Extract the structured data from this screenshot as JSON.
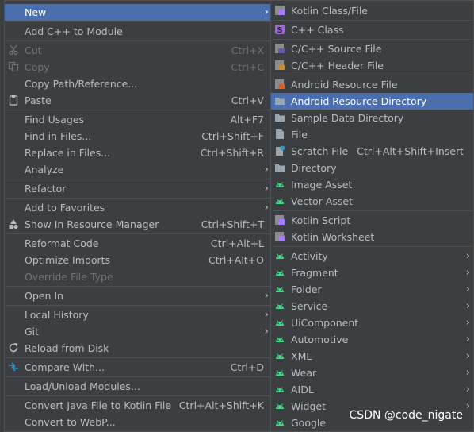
{
  "left_menu": {
    "new": "New",
    "add_cpp": "Add C++ to Module",
    "cut": "Cut",
    "cut_sc": "Ctrl+X",
    "copy": "Copy",
    "copy_sc": "Ctrl+C",
    "copy_path": "Copy Path/Reference...",
    "paste": "Paste",
    "paste_sc": "Ctrl+V",
    "find_usages": "Find Usages",
    "find_usages_sc": "Alt+F7",
    "find_in_files": "Find in Files...",
    "find_in_files_sc": "Ctrl+Shift+F",
    "replace_in_files": "Replace in Files...",
    "replace_in_files_sc": "Ctrl+Shift+R",
    "analyze": "Analyze",
    "refactor": "Refactor",
    "add_favorites": "Add to Favorites",
    "show_resource": "Show In Resource Manager",
    "show_resource_sc": "Ctrl+Shift+T",
    "reformat": "Reformat Code",
    "reformat_sc": "Ctrl+Alt+L",
    "optimize": "Optimize Imports",
    "optimize_sc": "Ctrl+Alt+O",
    "override": "Override File Type",
    "open_in": "Open In",
    "local_history": "Local History",
    "git": "Git",
    "reload": "Reload from Disk",
    "compare": "Compare With...",
    "compare_sc": "Ctrl+D",
    "load_unload": "Load/Unload Modules...",
    "convert_java": "Convert Java File to Kotlin File",
    "convert_java_sc": "Ctrl+Alt+Shift+K",
    "convert_webp": "Convert to WebP..."
  },
  "right_menu": {
    "kotlin_class": "Kotlin Class/File",
    "cpp_class": "C++ Class",
    "cpp_source": "C/C++ Source File",
    "cpp_header": "C/C++ Header File",
    "res_file": "Android Resource File",
    "res_dir": "Android Resource Directory",
    "sample_dir": "Sample Data Directory",
    "file": "File",
    "scratch": "Scratch File",
    "scratch_sc": "Ctrl+Alt+Shift+Insert",
    "directory": "Directory",
    "image_asset": "Image Asset",
    "vector_asset": "Vector Asset",
    "kotlin_script": "Kotlin Script",
    "kotlin_worksheet": "Kotlin Worksheet",
    "activity": "Activity",
    "fragment": "Fragment",
    "folder": "Folder",
    "service": "Service",
    "uicomponent": "UiComponent",
    "automotive": "Automotive",
    "xml": "XML",
    "wear": "Wear",
    "aidl": "AIDL",
    "widget": "Widget",
    "google": "Google"
  },
  "watermark": "CSDN @code_nigate",
  "colors": {
    "menu_bg": "#3c3f41",
    "selected": "#4b6eaf",
    "text": "#bbbbbb",
    "disabled": "#6f7375",
    "android_green": "#3ddc84"
  }
}
